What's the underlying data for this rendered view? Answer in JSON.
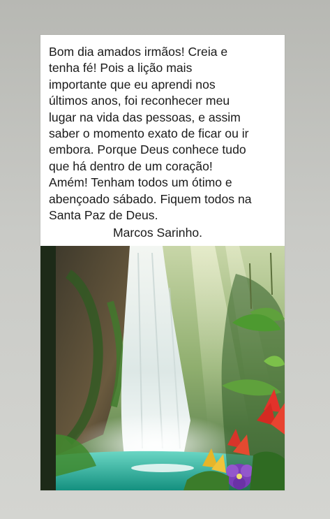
{
  "post": {
    "message": "Bom dia amados irmãos! Creia e\ntenha fé! Pois a lição mais\nimportante que eu aprendi nos\núltimos anos, foi reconhecer meu\nlugar na vida das pessoas, e assim\nsaber o momento exato de ficar ou ir\nembora. Porque Deus conhece tudo\nque há dentro de um coração!\nAmém! Tenham todos um ótimo e\nabençoado sábado. Fiquem todos na\nSanta Paz de Deus.",
    "signature": "Marcos Sarinho."
  },
  "image": {
    "subject": "waterfall-with-tropical-flowers"
  },
  "colors": {
    "background": "#c4c5c1",
    "card": "#ffffff",
    "text": "#1a1a1a",
    "water": "#2fb5a3"
  }
}
